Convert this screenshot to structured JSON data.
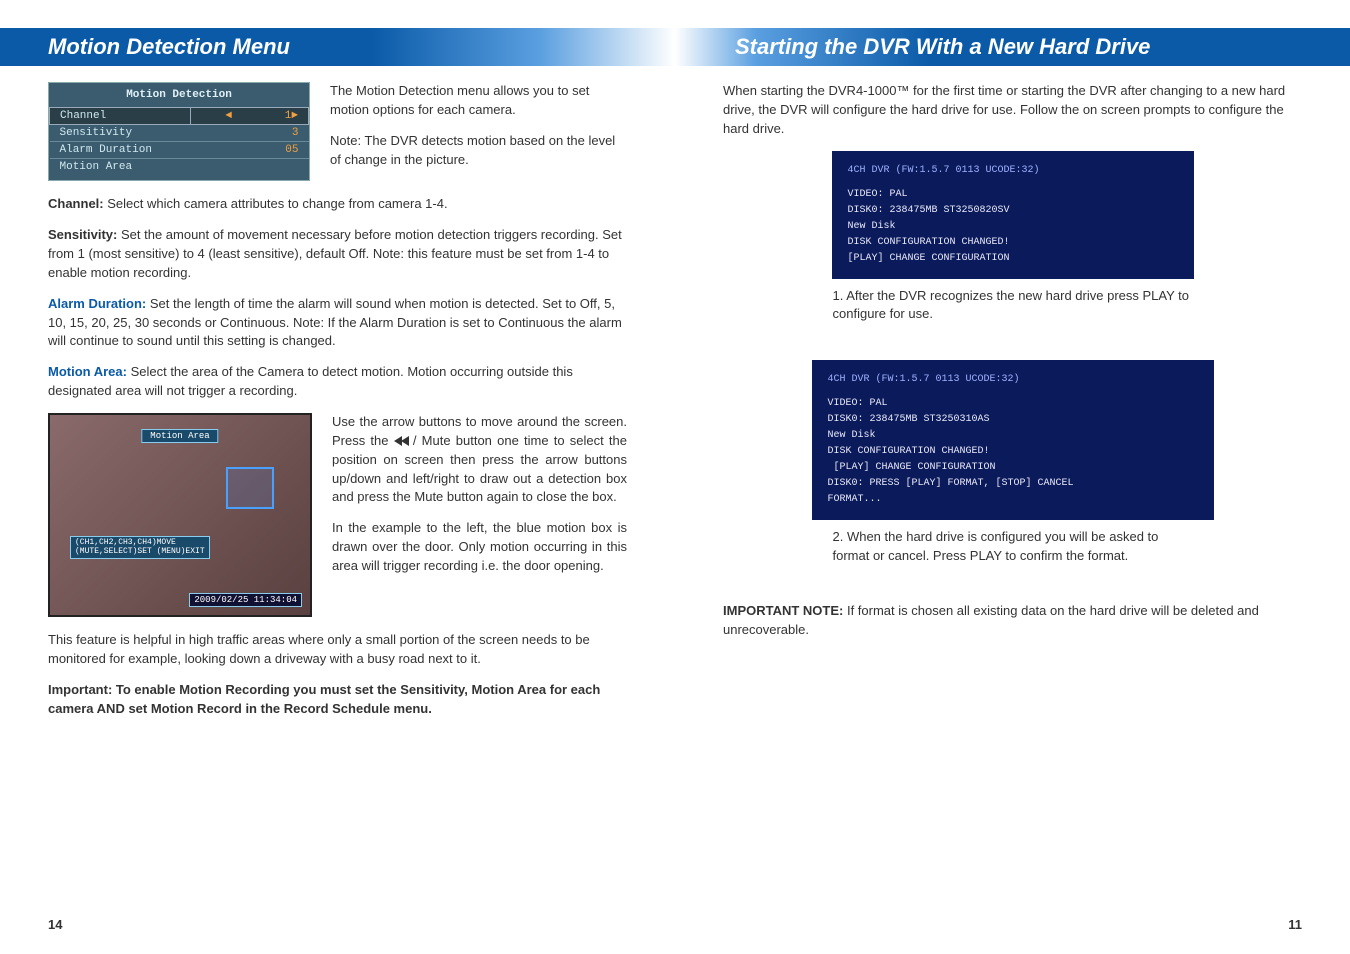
{
  "left": {
    "heading": "Motion Detection Menu",
    "motionMenu": {
      "title": "Motion Detection",
      "rows": [
        {
          "label": "Channel",
          "value": "1",
          "selected": true,
          "prefix": "◄",
          "suffix": "►"
        },
        {
          "label": "Sensitivity",
          "value": "3"
        },
        {
          "label": "Alarm Duration",
          "value": "05"
        },
        {
          "label": "Motion Area",
          "value": ""
        }
      ]
    },
    "intro1": "The Motion Detection menu allows you to set motion options for each camera.",
    "intro2": "Note: The DVR detects motion based on the level of change in the picture.",
    "channel": {
      "label": "Channel:",
      "text": "  Select which camera attributes to change from camera 1-4."
    },
    "sensitivity": {
      "label": "Sensitivity:",
      "text": "  Set the amount of movement necessary before motion detection triggers recording.  Set from 1 (most sensitive) to 4 (least sensitive), default Off. Note: this feature must be set from 1-4 to enable motion recording."
    },
    "alarm": {
      "label": "Alarm Duration:",
      "text": "  Set the length of time the alarm will sound when motion is detected.  Set to Off, 5, 10, 15, 20, 25, 30 seconds or Continuous.  Note: If the Alarm Duration is set to Continuous the alarm will continue to sound until this setting is changed."
    },
    "motionArea": {
      "label": "Motion Area:",
      "text": "  Select the area of the Camera to detect motion.  Motion occurring outside this designated area will not trigger a recording."
    },
    "motionAreaImg": {
      "topLabel": "Motion Area",
      "statusLine1": "(CH1,CH2,CH3,CH4)MOVE",
      "statusLine2": "(MUTE,SELECT)SET (MENU)EXIT",
      "timestamp": "2009/02/25 11:34:04"
    },
    "usage1a": "Use the arrow buttons to move around the screen.  Press the ",
    "usage1b": " / Mute button one time to select the position on screen then press the arrow buttons up/down and left/right to draw out a detection box and press the Mute button again to close the box.",
    "usage2": "In the example to the left, the blue motion box is drawn over the door.  Only motion occurring in this area will trigger recording i.e. the door opening.",
    "traffic": "This feature is helpful in high traffic areas where only a small portion of the screen needs to be monitored for example, looking down a driveway with a busy road next to it.",
    "important": "Important:  To enable Motion Recording you must set the Sensitivity,  Motion Area for each camera AND set Motion Record in the Record Schedule menu.",
    "pageNum": "14"
  },
  "right": {
    "heading": "Starting the DVR With a New Hard Drive",
    "intro": "When starting the DVR4-1000™ for the first time or starting the DVR after changing to a new hard drive, the DVR will configure the hard drive for use.  Follow the on screen prompts to configure the hard drive.",
    "screen1": {
      "header": "4CH DVR (FW:1.5.7 0113 UCODE:32)",
      "body": "VIDEO: PAL\nDISK0: 238475MB ST3250820SV\nNew Disk\nDISK CONFIGURATION CHANGED!\n[PLAY] CHANGE CONFIGURATION"
    },
    "caption1": "1. After the DVR recognizes the new hard drive press PLAY to configure for use.",
    "screen2": {
      "header": "4CH DVR (FW:1.5.7 0113 UCODE:32)",
      "body": "VIDEO: PAL\nDISK0: 238475MB ST3250310AS\nNew Disk\nDISK CONFIGURATION CHANGED!\n [PLAY] CHANGE CONFIGURATION\nDISK0: PRESS [PLAY] FORMAT, [STOP] CANCEL\nFORMAT..."
    },
    "caption2": "2.  When the hard drive is configured you will be asked to format or cancel.  Press PLAY to confirm the format.",
    "important": {
      "label": "IMPORTANT NOTE:",
      "text": "  If format is chosen all existing data on the hard drive will be deleted and unrecoverable."
    },
    "pageNum": "11"
  }
}
